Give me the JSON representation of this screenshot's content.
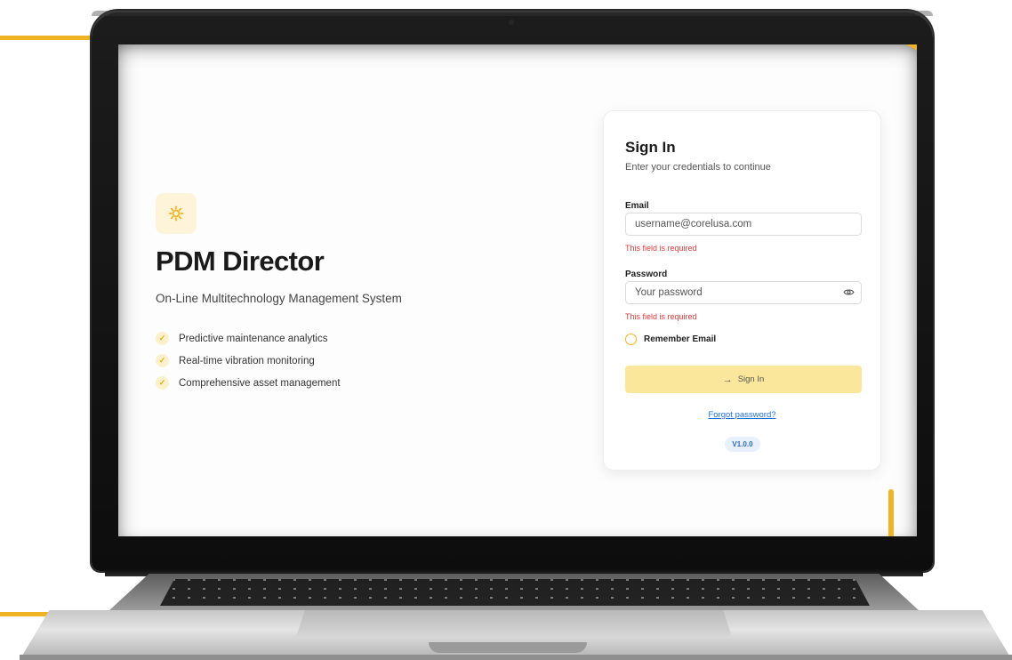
{
  "app": {
    "name": "PDM Director",
    "tagline": "On-Line Multitechnology Management System",
    "features": [
      "Predictive maintenance analytics",
      "Real-time vibration monitoring",
      "Comprehensive asset management"
    ],
    "logo_icon": "gear-sun-icon",
    "accent_color": "#f0b323"
  },
  "signin": {
    "title": "Sign In",
    "subtitle": "Enter your credentials to continue",
    "email": {
      "label": "Email",
      "placeholder": "username@corelusa.com",
      "value": "",
      "error": "This field is required"
    },
    "password": {
      "label": "Password",
      "placeholder": "Your password",
      "value": "",
      "error": "This field is required",
      "toggle_icon": "eye-icon"
    },
    "remember": {
      "label": "Remember Email",
      "checked": false
    },
    "submit": {
      "label": "Sign In",
      "icon": "arrow-right-icon"
    },
    "forgot_link": "Forgot password?",
    "version": "V1.0.0"
  },
  "colors": {
    "error": "#e03a3a",
    "link": "#1e6fd9",
    "button_bg": "#fbe79b"
  }
}
